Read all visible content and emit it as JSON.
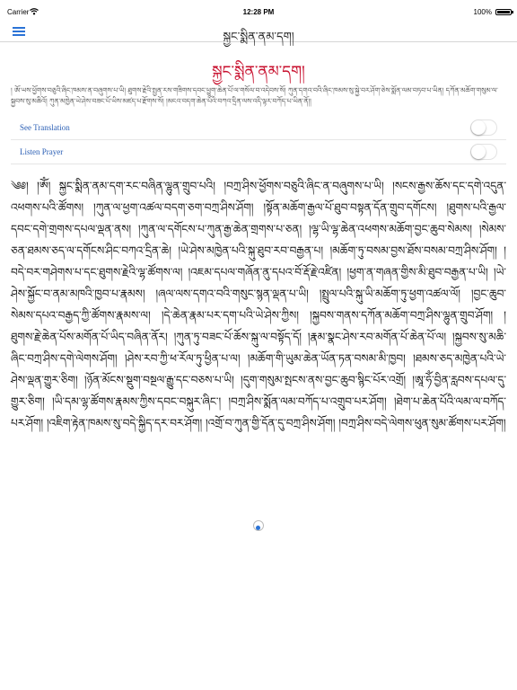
{
  "status_bar": {
    "carrier": "Carrier",
    "time": "12:28 PM",
    "battery": "100%"
  },
  "nav": {
    "title": "སྐྱང་སྨིན་ནམ་དག།"
  },
  "page": {
    "title": "སྐྱང་སྨིན་ནམ་དག།",
    "intro": "། ཨོ་ཡས་ཕྱོགས་བཅུའི་ཞིང་ཁམས་ན་བཞུགས་པ་ཡི། ཐུགས་རྗེའི་སྤྱན་རས་གཟིགས་དབང་ཕྱུག་ཆེན་པོ་ལ་གསོལ་བ་འདེབས་སོ། ཀུན་དགའ་བའི་ཞིང་ཁམས་སུ་སྐྱེ་བར་ཤོག་ཅེས་སྨོན་ལམ་བཏབ་པ་ཡིན། དཀོན་མཆོག་གསུམ་ལ་སྐྱབས་སུ་མཆིའོ། ཀུན་མཁྱེན་ཡེ་ཤེས་བཟང་པོ་ཡིས་མཛད་པ་རྫོགས་སོ། །མངའ་བདག་ཆེན་པོའི་བཀའ་དྲིན་ལས་འདི་ལྟར་བཀོད་པ་ཡིན་ནོ།།"
  },
  "toggles": {
    "translation_label": "See Translation",
    "listen_label": "Listen Prayer"
  },
  "prayer": {
    "text": "༄༅། །ཨོཾ། སྐྱང་སྨིན་ནམ་དག་རང་བཞིན་ལྷུན་གྲུབ་པའི། །བཀྲ་ཤིས་ཕྱོགས་བཅུའི་ཞིང་ན་བཞུགས་པ་ཡི། །སངས་རྒྱས་ཆོས་དང་དགེ་འདུན་འཕགས་པའི་ཚོགས། །ཀུན་ལ་ཕྱག་འཚལ་བདག་ཅག་བཀྲ་ཤིས་ཤོག། །སྟོན་མཆོག་རྒྱལ་པོ་ཐུབ་བསྟན་དོན་གྲུབ་དགོངས། །ཐུགས་པའི་རྒྱལ་དབང་དགེ་གྲགས་དཔལ་ལྡན་ནས། །ཀུན་ལ་དགོངས་པ་ཀུན་རྒྱ་ཆེན་གྲགས་པ་ཅན། །ལྷ་ཡི་ལྷ་ཆེན་འཕགས་མཆོག་བྱང་ཆུབ་སེམས། །སེམས་ཅན་ཐམས་ཅད་ལ་དགོངས་ཤིང་བཀའ་དྲིན་ཆེ། །ཡེ་ཤེས་མཁྱེན་པའི་སྐུ་ཐུབ་རབ་བརྒྱན་པ། །མཆོག་ཏུ་བསམ་བྱས་ཐོས་བསམ་བཀྲ་ཤིས་ཤོག། །བདེ་བར་གཤེགས་པ་དང་ཐུགས་རྗེའི་ལྷ་ཚོགས་ལ། །འཇམ་དཔལ་གཞོན་ནུ་དཔའ་བོ་རྡོ་རྗེ་འཛིན། །ཕྱག་ན་གཞན་གྱིས་མི་ཐུབ་བརྒྱན་པ་ཡི། །ཡེ་ཤེས་སྐྱོང་བ་ནམ་མཁའི་ཁྱབ་པ་རྣམས། །ཞལ་ལས་དགའ་བའི་གསུང་སྙན་ལྡན་པ་ཡི། །སྤྲུལ་པའི་སྐུ་ཡི་མཆོག་ཏུ་ཕྱག་འཚལ་ལོ། །བྱང་ཆུབ་སེམས་དཔའ་བརྒྱད་ཀྱི་ཚོགས་རྣམས་ལ། །དེ་ཆེན་རྣམ་པར་དག་པའི་ཡེ་ཤེས་ཀྱིས། །སྐྱབས་གནས་དཀོན་མཆོག་བཀྲ་ཤིས་ལྷུན་གྲུབ་ཤོག། །ཐུགས་རྗེ་ཆེན་པོས་མགོན་པོ་ཡིད་བཞིན་ནོར། །ཀུན་ཏུ་བཟང་པོ་ཆོས་སྐུ་ལ་བསྟོད་དོ། །རྣམ་སྣང་ཤེས་རབ་མགོན་པོ་ཆེན་པོ་ལ། །སྐྱབས་སུ་མཆི་ཞིང་བཀྲ་ཤིས་དགེ་ལེགས་ཤོག། །ཤེས་རབ་ཀྱི་ཕ་རོལ་ཏུ་ཕྱིན་པ་ལ། །མཆོག་གི་ཡུམ་ཆེན་ཡོན་ཏན་བསམ་མི་ཁྱབ། །ཐམས་ཅད་མཁྱེན་པའི་ཡེ་ཤེས་ལྡན་གྱུར་ཅིག། །ཉོན་མོངས་སྡུག་བསྔལ་རྒྱུ་དང་བཅས་པ་ཡི། །དུག་གསུམ་སྤངས་ནས་བྱང་ཆུབ་སྙིང་པོར་འགྲོ། །ཨཱ་ཧོཾ་བྱིན་རླབས་དཔལ་དུ་གྱུར་ཅིག། །ཡི་དམ་ལྷ་ཚོགས་རྣམས་ཀྱིས་དབང་བསྐུར་ཞིང་། །བཀྲ་ཤིས་སྨོན་ལམ་བཀོད་པ་འགྲུབ་པར་ཤོག། །ཐེག་པ་ཆེན་པོའི་ལམ་ལ་བཀོད་པར་ཤོག། །འཇིག་རྟེན་ཁམས་སུ་བདེ་སྐྱིད་དར་བར་ཤོག། །འགྲོ་བ་ཀུན་གྱི་དོན་དུ་བཀྲ་ཤིས་ཤོག། །བཀྲ་ཤིས་བདེ་ལེགས་ཕུན་སུམ་ཚོགས་པར་ཤོག།"
  },
  "colors": {
    "title": "#c8102e",
    "accent": "#2b73d6",
    "link": "#2b5fb5"
  }
}
